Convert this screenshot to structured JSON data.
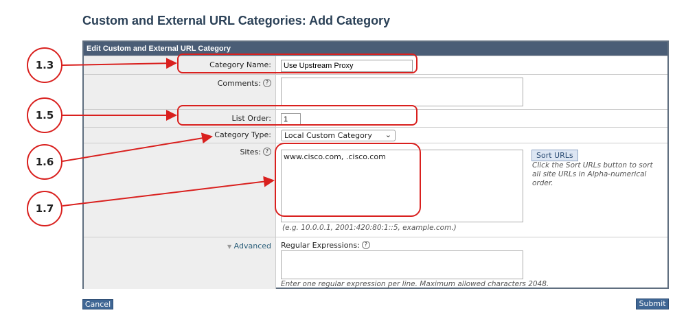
{
  "page_title": "Custom and External URL Categories: Add Category",
  "panel_title": "Edit Custom and External URL Category",
  "fields": {
    "category_name": {
      "label": "Category Name:",
      "value": "Use Upstream Proxy"
    },
    "comments": {
      "label": "Comments:",
      "value": ""
    },
    "list_order": {
      "label": "List Order:",
      "value": "1"
    },
    "category_type": {
      "label": "Category Type:",
      "value": "Local Custom Category"
    },
    "sites": {
      "label": "Sites:",
      "value": "www.cisco.com, .cisco.com",
      "hint": "(e.g. 10.0.0.1, 2001:420:80:1::5, example.com.)",
      "sort_button": "Sort URLs",
      "sort_note": "Click the Sort URLs button to sort all site URLs in Alpha-numerical order."
    },
    "advanced": {
      "label": "Advanced",
      "regex_label": "Regular Expressions:",
      "value": "",
      "hint": "Enter one regular expression per line. Maximum allowed characters 2048."
    }
  },
  "help_glyph": "?",
  "buttons": {
    "cancel": "Cancel",
    "submit": "Submit"
  },
  "annotations": [
    "1.3",
    "1.5",
    "1.6",
    "1.7"
  ],
  "accent": "#d9201e"
}
